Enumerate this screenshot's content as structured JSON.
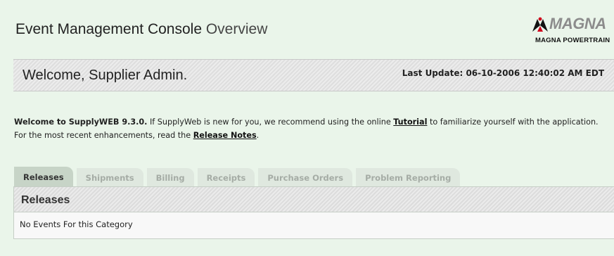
{
  "header": {
    "title_main": "Event Management Console",
    "title_sub": "Overview"
  },
  "logo": {
    "brand": "MAGNA",
    "subtitle": "MAGNA POWERTRAIN",
    "icon": "magna-logo-mark"
  },
  "welcome": {
    "greeting": "Welcome, Supplier Admin.",
    "last_update": "Last Update: 06-10-2006 12:40:02 AM EDT"
  },
  "intro": {
    "lead": "Welcome to SupplyWEB 9.3.0.",
    "text1": " If SupplyWeb is new for you, we recommend using the online ",
    "tutorial_link": "Tutorial",
    "text2": " to familiarize yourself with the application. For the most recent enhancements, read the ",
    "release_notes_link": "Release Notes",
    "text3": "."
  },
  "tabs": [
    {
      "label": "Releases",
      "active": true
    },
    {
      "label": "Shipments",
      "active": false
    },
    {
      "label": "Billing",
      "active": false
    },
    {
      "label": "Receipts",
      "active": false
    },
    {
      "label": "Purchase Orders",
      "active": false
    },
    {
      "label": "Problem Reporting",
      "active": false
    }
  ],
  "panel": {
    "heading": "Releases",
    "empty_message": "No Events For this Category"
  },
  "colors": {
    "page_bg": "#eaf5ea",
    "tab_active": "#c7d4c7",
    "tab_inactive": "#dfe8df",
    "logo_red": "#d0021b"
  }
}
